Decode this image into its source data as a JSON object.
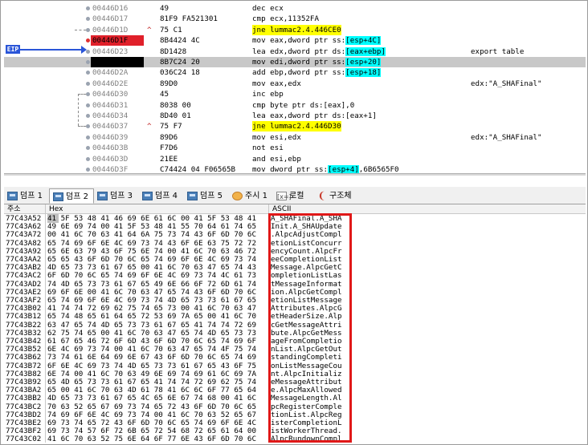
{
  "eip_label": "EIP",
  "disasm": [
    {
      "addr": "00446D16",
      "bytes": "49",
      "arrow": "",
      "mnem": "dec ecx",
      "comment": "",
      "state": "",
      "dot": ""
    },
    {
      "addr": "00446D17",
      "bytes": "81F9 FA521301",
      "arrow": "",
      "mnem": "cmp ecx,11352FA",
      "comment": "",
      "state": "",
      "dot": ""
    },
    {
      "addr": "00446D1D",
      "bytes": "75 C1",
      "arrow": "^",
      "mnem": "jne lummac2.4.446CE0",
      "comment": "",
      "state": "",
      "dot": "",
      "mnem_jne": true
    },
    {
      "addr": "00446D1F",
      "bytes": "8B4424 4C",
      "arrow": "",
      "mnem": "mov eax,dword ptr ss:[esp+4C]",
      "comment": "",
      "state": "bp",
      "dot": "red"
    },
    {
      "addr": "00446D23",
      "bytes": "8D1428",
      "arrow": "",
      "mnem": "lea edx,dword ptr ds:[eax+ebp]",
      "comment": "export table",
      "state": "",
      "dot": ""
    },
    {
      "addr": "00446D26",
      "bytes": "8B7C24 20",
      "arrow": "",
      "mnem": "mov edi,dword ptr ss:[esp+20]",
      "comment": "",
      "state": "eip",
      "dot": ""
    },
    {
      "addr": "00446D2A",
      "bytes": "036C24 18",
      "arrow": "",
      "mnem": "add ebp,dword ptr ss:[esp+18]",
      "comment": "",
      "state": "",
      "dot": ""
    },
    {
      "addr": "00446D2E",
      "bytes": "89D0",
      "arrow": "",
      "mnem": "mov eax,edx",
      "comment": "edx:\"A_SHAFinal\"",
      "state": "",
      "dot": ""
    },
    {
      "addr": "00446D30",
      "bytes": "45",
      "arrow": "",
      "mnem": "inc ebp",
      "comment": "",
      "state": "",
      "dot": ""
    },
    {
      "addr": "00446D31",
      "bytes": "8038 00",
      "arrow": "",
      "mnem": "cmp byte ptr ds:[eax],0",
      "comment": "",
      "state": "",
      "dot": ""
    },
    {
      "addr": "00446D34",
      "bytes": "8D40 01",
      "arrow": "",
      "mnem": "lea eax,dword ptr ds:[eax+1]",
      "comment": "",
      "state": "",
      "dot": ""
    },
    {
      "addr": "00446D37",
      "bytes": "75 F7",
      "arrow": "^",
      "mnem": "jne lummac2.4.446D30",
      "comment": "",
      "state": "",
      "dot": "",
      "mnem_jne": true
    },
    {
      "addr": "00446D39",
      "bytes": "89D6",
      "arrow": "",
      "mnem": "mov esi,edx",
      "comment": "edx:\"A_SHAFinal\"",
      "state": "",
      "dot": ""
    },
    {
      "addr": "00446D3B",
      "bytes": "F7D6",
      "arrow": "",
      "mnem": "not esi",
      "comment": "",
      "state": "",
      "dot": ""
    },
    {
      "addr": "00446D3D",
      "bytes": "21EE",
      "arrow": "",
      "mnem": "and esi,ebp",
      "comment": "",
      "state": "",
      "dot": ""
    },
    {
      "addr": "00446D3F",
      "bytes": "C74424 04 F06565B",
      "arrow": "",
      "mnem": "mov dword ptr ss:[esp+4],6B6565F0",
      "comment": "",
      "state": "",
      "dot": ""
    },
    {
      "addr": "00446D47",
      "bytes": "31C0",
      "arrow": "",
      "mnem": "xor eax,eax",
      "comment": "",
      "state": "",
      "dot": ""
    },
    {
      "addr": "00446D49",
      "bytes": "90",
      "arrow": "",
      "mnem": "nop",
      "comment": "",
      "state": "",
      "dot": ""
    },
    {
      "addr": "00446D4A",
      "bytes": "90",
      "arrow": "",
      "mnem": "nop",
      "comment": "",
      "state": "",
      "dot": ""
    },
    {
      "addr": "00446D4B",
      "bytes": "90",
      "arrow": "",
      "mnem": "nop",
      "comment": "",
      "state": "",
      "dot": ""
    }
  ],
  "tabs": [
    {
      "label": "덤프 1",
      "icon": "dump-icon",
      "active": false
    },
    {
      "label": "덤프 2",
      "icon": "dump-icon",
      "active": true
    },
    {
      "label": "덤프 3",
      "icon": "dump-icon",
      "active": false
    },
    {
      "label": "덤프 4",
      "icon": "dump-icon",
      "active": false
    },
    {
      "label": "덤프 5",
      "icon": "dump-icon",
      "active": false
    },
    {
      "label": "주시 1",
      "icon": "watch-icon",
      "active": false
    },
    {
      "label": "로컬",
      "icon": "locals-icon",
      "active": false
    },
    {
      "label": "구조체",
      "icon": "struct-icon",
      "active": false
    }
  ],
  "dump_headers": {
    "addr": "주소",
    "hex": "Hex",
    "ascii": "ASCII"
  },
  "dump_rows": [
    {
      "addr": "77C43A52",
      "hex": "41 5F 53 48 41 46 69 6E 61 6C 00 41 5F 53 48 41",
      "ascii": "A_SHAFinal.A_SHA"
    },
    {
      "addr": "77C43A62",
      "hex": "49 6E 69 74 00 41 5F 53 48 41 55 70 64 61 74 65",
      "ascii": "Init.A_SHAUpdate"
    },
    {
      "addr": "77C43A72",
      "hex": "00 41 6C 70 63 41 64 6A 75 73 74 43 6F 6D 70 6C",
      "ascii": ".AlpcAdjustCompl"
    },
    {
      "addr": "77C43A82",
      "hex": "65 74 69 6F 6E 4C 69 73 74 43 6F 6E 63 75 72 72",
      "ascii": "etionListConcurr"
    },
    {
      "addr": "77C43A92",
      "hex": "65 6E 63 79 43 6F 75 6E 74 00 41 6C 70 63 46 72",
      "ascii": "encyCount.AlpcFr"
    },
    {
      "addr": "77C43AA2",
      "hex": "65 65 43 6F 6D 70 6C 65 74 69 6F 6E 4C 69 73 74",
      "ascii": "eeCompletionList"
    },
    {
      "addr": "77C43AB2",
      "hex": "4D 65 73 73 61 67 65 00 41 6C 70 63 47 65 74 43",
      "ascii": "Message.AlpcGetC"
    },
    {
      "addr": "77C43AC2",
      "hex": "6F 6D 70 6C 65 74 69 6F 6E 4C 69 73 74 4C 61 73",
      "ascii": "ompletionListLas"
    },
    {
      "addr": "77C43AD2",
      "hex": "74 4D 65 73 73 61 67 65 49 6E 66 6F 72 6D 61 74",
      "ascii": "tMessageInformat"
    },
    {
      "addr": "77C43AE2",
      "hex": "69 6F 6E 00 41 6C 70 63 47 65 74 43 6F 6D 70 6C",
      "ascii": "ion.AlpcGetCompl"
    },
    {
      "addr": "77C43AF2",
      "hex": "65 74 69 6F 6E 4C 69 73 74 4D 65 73 73 61 67 65",
      "ascii": "etionListMessage"
    },
    {
      "addr": "77C43B02",
      "hex": "41 74 74 72 69 62 75 74 65 73 00 41 6C 70 63 47",
      "ascii": "Attributes.AlpcG"
    },
    {
      "addr": "77C43B12",
      "hex": "65 74 48 65 61 64 65 72 53 69 7A 65 00 41 6C 70",
      "ascii": "etHeaderSize.Alp"
    },
    {
      "addr": "77C43B22",
      "hex": "63 47 65 74 4D 65 73 73 61 67 65 41 74 74 72 69",
      "ascii": "cGetMessageAttri"
    },
    {
      "addr": "77C43B32",
      "hex": "62 75 74 65 00 41 6C 70 63 47 65 74 4D 65 73 73",
      "ascii": "bute.AlpcGetMess"
    },
    {
      "addr": "77C43B42",
      "hex": "61 67 65 46 72 6F 6D 43 6F 6D 70 6C 65 74 69 6F",
      "ascii": "ageFromCompletio"
    },
    {
      "addr": "77C43B52",
      "hex": "6E 4C 69 73 74 00 41 6C 70 63 47 65 74 4F 75 74",
      "ascii": "nList.AlpcGetOut"
    },
    {
      "addr": "77C43B62",
      "hex": "73 74 61 6E 64 69 6E 67 43 6F 6D 70 6C 65 74 69",
      "ascii": "standingCompleti"
    },
    {
      "addr": "77C43B72",
      "hex": "6F 6E 4C 69 73 74 4D 65 73 73 61 67 65 43 6F 75",
      "ascii": "onListMessageCou"
    },
    {
      "addr": "77C43B82",
      "hex": "6E 74 00 41 6C 70 63 49 6E 69 74 69 61 6C 69 7A",
      "ascii": "nt.AlpcInitializ"
    },
    {
      "addr": "77C43B92",
      "hex": "65 4D 65 73 73 61 67 65 41 74 74 72 69 62 75 74",
      "ascii": "eMessageAttribut"
    },
    {
      "addr": "77C43BA2",
      "hex": "65 00 41 6C 70 63 4D 61 78 41 6C 6C 6F 77 65 64",
      "ascii": "e.AlpcMaxAllowed"
    },
    {
      "addr": "77C43BB2",
      "hex": "4D 65 73 73 61 67 65 4C 65 6E 67 74 68 00 41 6C",
      "ascii": "MessageLength.Al"
    },
    {
      "addr": "77C43BC2",
      "hex": "70 63 52 65 67 69 73 74 65 72 43 6F 6D 70 6C 65",
      "ascii": "pcRegisterComple"
    },
    {
      "addr": "77C43BD2",
      "hex": "74 69 6F 6E 4C 69 73 74 00 41 6C 70 63 52 65 67",
      "ascii": "tionList.AlpcReg"
    },
    {
      "addr": "77C43BE2",
      "hex": "69 73 74 65 72 43 6F 6D 70 6C 65 74 69 6F 6E 4C",
      "ascii": "isterCompletionL"
    },
    {
      "addr": "77C43BF2",
      "hex": "69 73 74 57 6F 72 6B 65 72 54 68 72 65 61 64 00",
      "ascii": "istWorkerThread."
    },
    {
      "addr": "77C43C02",
      "hex": "41 6C 70 63 52 75 6E 64 6F 77 6E 43 6F 6D 70 6C",
      "ascii": "AlpcRundownCompl"
    }
  ]
}
